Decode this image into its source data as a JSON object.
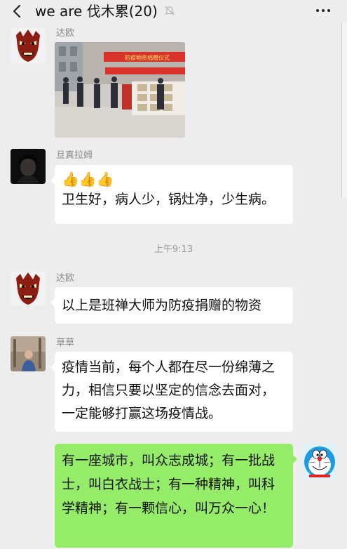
{
  "header": {
    "title": "we are 伐木累(20)"
  },
  "messages": [
    {
      "sender": "达欧",
      "type": "image"
    },
    {
      "sender": "旦真拉姆",
      "emoji": "👍👍👍",
      "text": "卫生好，病人少，锅灶净，少生病。"
    },
    {
      "sender": "达欧",
      "text": "以上是班禅大师为防疫捐赠的物资"
    },
    {
      "sender": "草草",
      "text": "疫情当前，每个人都在尽一份绵薄之力，相信只要以坚定的信念去面对，一定能够打赢这场疫情战。"
    },
    {
      "sender": "",
      "text": "有一座城市，叫众志成城；有一批战士，叫白衣战士；有一种精神，叫科学精神；有一颗信心，叫万众一心！"
    }
  ],
  "timestamp": "上午9:13",
  "photo_banner_text": "防疫物资捐赠仪式",
  "icons": [
    "back-arrow-icon",
    "mute-bell-icon",
    "more-dots-icon"
  ],
  "colors": {
    "bubble_self": "#95ec69",
    "bubble_other": "#ffffff",
    "background": "#ededed"
  }
}
